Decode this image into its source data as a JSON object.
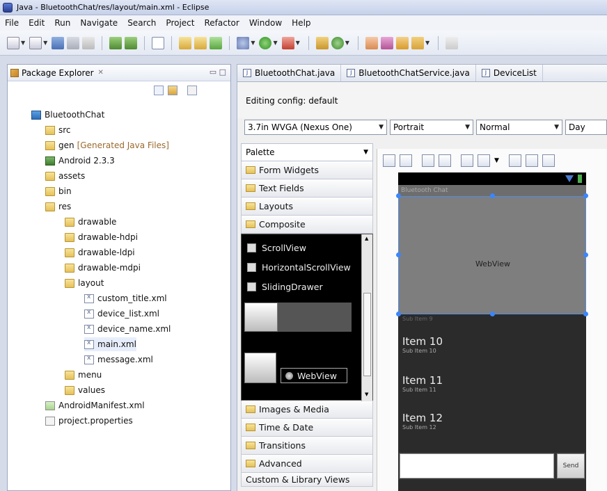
{
  "window": {
    "title": "Java - BluetoothChat/res/layout/main.xml - Eclipse"
  },
  "menu": [
    "File",
    "Edit",
    "Run",
    "Navigate",
    "Search",
    "Project",
    "Refactor",
    "Window",
    "Help"
  ],
  "package_explorer": {
    "title": "Package Explorer",
    "close_glyph": "✕",
    "minmax_glyph": "▭ □",
    "tree": [
      {
        "label": "BluetoothChat",
        "icon": "project"
      },
      {
        "label": "src",
        "icon": "src-folder"
      },
      {
        "label": "gen",
        "extra": "[Generated Java Files]",
        "icon": "src-folder"
      },
      {
        "label": "Android 2.3.3",
        "icon": "library"
      },
      {
        "label": "assets",
        "icon": "folder"
      },
      {
        "label": "bin",
        "icon": "folder"
      },
      {
        "label": "res",
        "icon": "folder"
      },
      {
        "label": "drawable",
        "icon": "folder"
      },
      {
        "label": "drawable-hdpi",
        "icon": "folder"
      },
      {
        "label": "drawable-ldpi",
        "icon": "folder"
      },
      {
        "label": "drawable-mdpi",
        "icon": "folder"
      },
      {
        "label": "layout",
        "icon": "folder"
      },
      {
        "label": "custom_title.xml",
        "icon": "xml-file"
      },
      {
        "label": "device_list.xml",
        "icon": "xml-file"
      },
      {
        "label": "device_name.xml",
        "icon": "xml-file"
      },
      {
        "label": "main.xml",
        "icon": "xml-file"
      },
      {
        "label": "message.xml",
        "icon": "xml-file"
      },
      {
        "label": "menu",
        "icon": "folder"
      },
      {
        "label": "values",
        "icon": "folder"
      },
      {
        "label": "AndroidManifest.xml",
        "icon": "manifest-file"
      },
      {
        "label": "project.properties",
        "icon": "properties-file"
      }
    ]
  },
  "editor_tabs": [
    "BluetoothChat.java",
    "BluetoothChatService.java",
    "DeviceList"
  ],
  "editing_config": "Editing config: default",
  "config": {
    "device": "3.7in WVGA (Nexus One)",
    "orientation": "Portrait",
    "density": "Normal",
    "mode": "Day"
  },
  "palette": {
    "title": "Palette",
    "categories_top": [
      "Form Widgets",
      "Text Fields",
      "Layouts",
      "Composite"
    ],
    "composite_items": [
      "ScrollView",
      "HorizontalScrollView",
      "SlidingDrawer"
    ],
    "webview_item": "WebView",
    "categories_bottom": [
      "Images & Media",
      "Time & Date",
      "Transitions",
      "Advanced",
      "Custom & Library Views"
    ]
  },
  "device": {
    "app_title": "Bluetooth Chat",
    "webview_label": "WebView",
    "hidden_sub": "Sub Item 9",
    "items": [
      {
        "title": "Item 10",
        "sub": "Sub Item 10"
      },
      {
        "title": "Item 11",
        "sub": "Sub Item 11"
      },
      {
        "title": "Item 12",
        "sub": "Sub Item 12"
      }
    ],
    "send_label": "Send"
  }
}
